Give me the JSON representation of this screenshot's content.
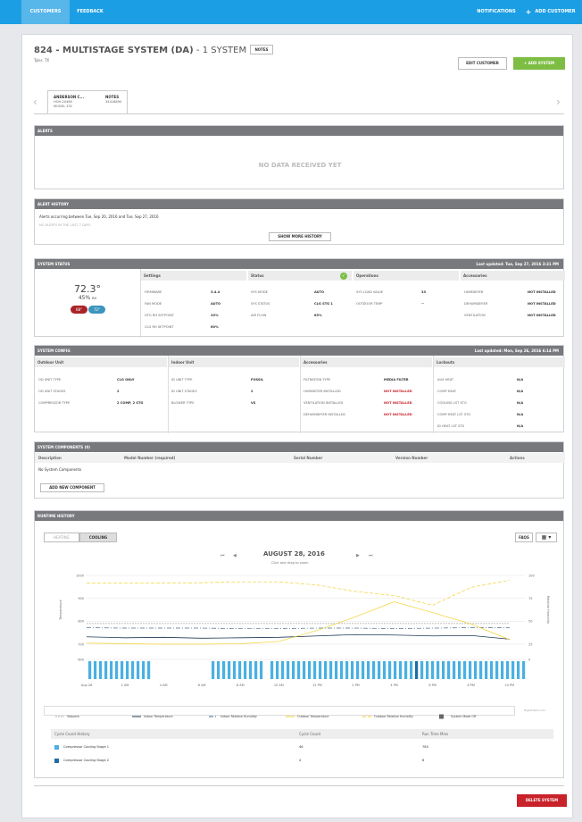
{
  "nav": {
    "customers": "CUSTOMERS",
    "feedback": "FEEDBACK",
    "notifications": "NOTIFICATIONS",
    "add_customer": "ADD CUSTOMER",
    "plus": "+"
  },
  "header": {
    "title": "824 - MULTISTAGE SYSTEM (DA)",
    "title_suffix": " - 1 SYSTEM",
    "notes": "NOTES",
    "location": "Tyler, TX",
    "edit_customer": "EDIT CUSTOMER",
    "add_system": "ADD SYSTEM",
    "add_plus": "+"
  },
  "device_tab": {
    "name": "ANDERSON C...",
    "line2": "HOH-20480",
    "line3": "MODEL 332",
    "notes_label": "NOTES",
    "notes_value": "34418890",
    "left_arrow": "‹",
    "right_arrow": "›"
  },
  "alerts": {
    "title": "ALERTS",
    "empty": "NO DATA RECEIVED YET"
  },
  "alert_history": {
    "title": "ALERT HISTORY",
    "range": "Alerts occurring between Tue, Sep 20, 2016 and Tue, Sep 27, 2016",
    "none": "NO ALERTS IN THE LAST 7 DAYS",
    "show_more": "SHOW MORE HISTORY"
  },
  "system_status": {
    "title": "SYSTEM STATUS",
    "updated": "Last updated: Tue, Sep 27, 2016 3:31 PM",
    "temperature": "72.3°",
    "humidity": "45%",
    "humidity_unit": "RH",
    "heat_setpoint": "68°",
    "cool_setpoint": "72°",
    "columns": [
      "Settings",
      "Status",
      "Operations",
      "Accessories"
    ],
    "settings": [
      [
        "FIRMWARE",
        "3.4.4"
      ],
      [
        "FAN MODE",
        "AUTO"
      ],
      [
        "HTG RH SETPOINT",
        "20%"
      ],
      [
        "CLG RH SETPOINT",
        "60%"
      ]
    ],
    "status": [
      [
        "SYS MODE",
        "AUTO"
      ],
      [
        "SYS STATUS",
        "CLG STG 1"
      ],
      [
        "AIR FLOW",
        "85%"
      ]
    ],
    "operations": [
      [
        "SYS LOAD VALUE",
        "33"
      ],
      [
        "OUTDOOR TEMP",
        "--"
      ]
    ],
    "accessories": [
      [
        "HUMIDIFIER",
        "NOT INSTALLED"
      ],
      [
        "DEHUMIDIFIER",
        "NOT INSTALLED"
      ],
      [
        "VENTILATION",
        "NOT INSTALLED"
      ]
    ]
  },
  "system_config": {
    "title": "SYSTEM CONFIG",
    "updated": "Last updated: Mon, Sep 26, 2016 6:14 PM",
    "columns": [
      "Outdoor Unit",
      "Indoor Unit",
      "Accessories",
      "Lockouts"
    ],
    "outdoor": [
      [
        "OD UNIT TYPE",
        "CLG ONLY"
      ],
      [
        "OD UNIT STAGES",
        "2"
      ],
      [
        "COMPRESSOR TYPE",
        "2 COMP, 2 STG"
      ]
    ],
    "indoor": [
      [
        "ID UNIT TYPE",
        "FOSSIL"
      ],
      [
        "ID UNIT STAGES",
        "2"
      ],
      [
        "BLOWER TYPE",
        "VS"
      ]
    ],
    "accessories": [
      [
        "FILTRATION TYPE",
        "MEDIA FILTER"
      ],
      [
        "HUMIDIFIER INSTALLED",
        "NOT INSTALLED"
      ],
      [
        "VENTILATION INSTALLED",
        "NOT INSTALLED"
      ],
      [
        "DEHUMIDIFIER INSTALLED",
        "NOT INSTALLED"
      ]
    ],
    "lockouts": [
      [
        "AUX HEAT",
        "N/A"
      ],
      [
        "COMP HEAT",
        "N/A"
      ],
      [
        "COOLING LST STG",
        "N/A"
      ],
      [
        "COMP HEAT LST STG",
        "N/A"
      ],
      [
        "ID HEAT LST STG",
        "N/A"
      ]
    ]
  },
  "components": {
    "title": "SYSTEM COMPONENTS (0)",
    "headers": [
      "Description",
      "Model Number (required)",
      "Serial Number",
      "Version Number",
      "Actions"
    ],
    "empty": "No System Components",
    "add": "ADD NEW COMPONENT"
  },
  "runtime": {
    "title": "RUNTIME HISTORY",
    "tab_heating": "HEATING",
    "tab_cooling": "COOLING",
    "faqs": "FAQS",
    "date": "AUGUST 28, 2016",
    "instruction": "Click and drag to zoom",
    "nav_first": "⏮",
    "nav_prev": "◀",
    "nav_next": "▶",
    "nav_last": "⏭",
    "calendar": "▦",
    "caret": "▾",
    "ylabel_left": "Temperature",
    "ylabel_right": "Relative Humidity",
    "credit": "Highcharts.com",
    "legend": [
      "Setpoint",
      "Indoor Temperature",
      "Indoor Relative Humidity",
      "Outdoor Temperature",
      "Outdoor Relative Humidity",
      "System Mode Off"
    ],
    "cycle_headers": [
      "Cycle Count History",
      "Cycle Count",
      "Run Time Mins"
    ],
    "cycle_rows": [
      [
        "Compressor Cooling Stage 1",
        "46",
        "780"
      ],
      [
        "Compressor Cooling Stage 2",
        "4",
        "8"
      ]
    ]
  },
  "footer": {
    "delete": "DELETE SYSTEM"
  },
  "chart_data": {
    "type": "line",
    "title": "AUGUST 28, 2016",
    "x_labels": [
      "Aug 28",
      "2 AM",
      "4 AM",
      "6 AM",
      "8 AM",
      "10 AM",
      "12 PM",
      "2 PM",
      "4 PM",
      "6 PM",
      "8 PM",
      "10 PM"
    ],
    "left_axis": {
      "ticks": [
        "1000",
        "900",
        "800",
        "700"
      ],
      "ylim": [
        700,
        1000
      ]
    },
    "right_axis": {
      "ticks": [
        "100",
        "75",
        "50",
        "25"
      ],
      "ylim": [
        25,
        100
      ]
    },
    "bar_axis": {
      "ticks": [
        "600"
      ],
      "right_ticks": [
        "0"
      ]
    },
    "series": [
      {
        "name": "Setpoint",
        "color": "#aaaaaa",
        "dash": "2,1",
        "values": [
          790,
          790,
          790,
          790,
          790,
          790,
          790,
          790,
          790,
          790,
          790,
          790
        ]
      },
      {
        "name": "Indoor Temperature",
        "color": "#1f3a56",
        "values": [
          732,
          728,
          730,
          726,
          728,
          730,
          736,
          742,
          740,
          736,
          738,
          722
        ]
      },
      {
        "name": "Indoor Relative Humidity",
        "color": "#4a6d8c",
        "dash": "5,2,1,2",
        "values": [
          772,
          770,
          770,
          770,
          768,
          768,
          770,
          770,
          768,
          770,
          772,
          772
        ]
      },
      {
        "name": "Outdoor Temperature",
        "color": "#f2d230",
        "values": [
          705,
          702,
          700,
          700,
          702,
          712,
          760,
          820,
          885,
          838,
          788,
          720
        ]
      },
      {
        "name": "Outdoor Relative Humidity",
        "color": "#f2d230",
        "dash": "4,2",
        "values": [
          966,
          966,
          966,
          968,
          972,
          972,
          958,
          930,
          912,
          870,
          948,
          978
        ]
      }
    ]
  }
}
